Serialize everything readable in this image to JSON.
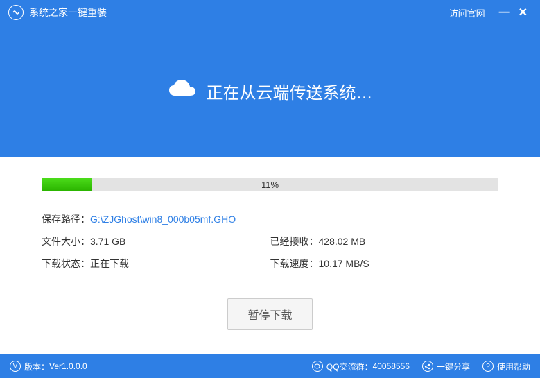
{
  "titlebar": {
    "title": "系统之家一键重装",
    "visit_link": "访问官网",
    "minimize": "—",
    "close": "✕"
  },
  "hero": {
    "text": "正在从云端传送系统…"
  },
  "progress": {
    "percent": 11,
    "percent_text": "11%"
  },
  "info": {
    "save_path_label": "保存路径：",
    "save_path_value": "G:\\ZJGhost\\win8_000b05mf.GHO",
    "file_size_label": "文件大小：",
    "file_size_value": "3.71 GB",
    "received_label": "已经接收：",
    "received_value": "428.02 MB",
    "status_label": "下载状态：",
    "status_value": "正在下载",
    "speed_label": "下载速度：",
    "speed_value": "10.17 MB/S"
  },
  "buttons": {
    "pause": "暂停下载"
  },
  "footer": {
    "version_label": "版本：",
    "version_value": "Ver1.0.0.0",
    "qq_label": "QQ交流群：",
    "qq_value": "40058556",
    "share": "一键分享",
    "help": "使用帮助"
  }
}
